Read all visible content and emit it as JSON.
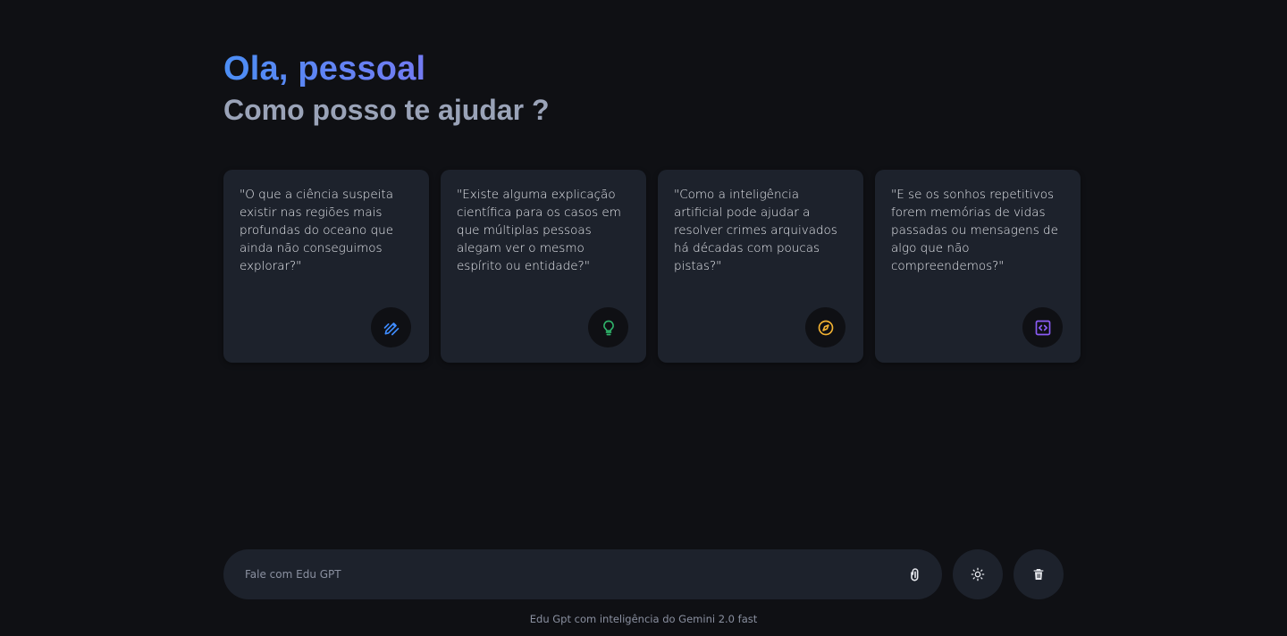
{
  "header": {
    "greeting": "Ola, pessoal",
    "subtitle": "Como posso te ajudar ?"
  },
  "cards": [
    {
      "text": "\"O que a ciência suspeita existir nas regiões mais profundas do oceano que ainda não conseguimos explorar?\"",
      "icon": "edit-pencil-icon",
      "icon_color": "#3f8cff"
    },
    {
      "text": "\"Existe alguma explicação científica para os casos em que múltiplas pessoas alegam ver o mesmo espírito ou entidade?\"",
      "icon": "lightbulb-icon",
      "icon_color": "#2fb36a"
    },
    {
      "text": "\"Como a inteligência artificial pode ajudar a resolver crimes arquivados há décadas com poucas pistas?\"",
      "icon": "compass-icon",
      "icon_color": "#f2b232"
    },
    {
      "text": "\"E se os sonhos repetitivos forem memórias de vidas passadas ou mensagens de algo que não compreendemos?\"",
      "icon": "code-icon",
      "icon_color": "#8a5cf6"
    }
  ],
  "composer": {
    "placeholder": "Fale com Edu GPT",
    "attach_icon": "paperclip-icon",
    "theme_icon": "sun-icon",
    "delete_icon": "trash-icon"
  },
  "footer": {
    "text": "Edu Gpt com inteligência do Gemini 2.0 fast"
  },
  "colors": {
    "background": "#0f1014",
    "card": "#1d222c",
    "gradient_start": "#4c8ef5",
    "gradient_end": "#8b6ff0"
  }
}
